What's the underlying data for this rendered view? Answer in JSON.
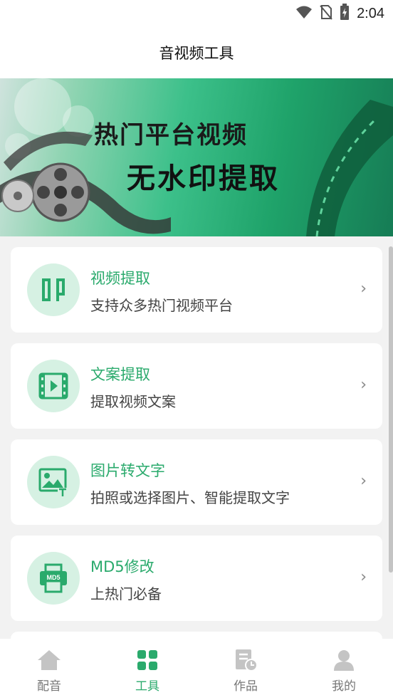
{
  "status_bar": {
    "time": "2:04",
    "icons": [
      "wifi-icon",
      "no-sim-icon",
      "battery-charging-icon"
    ]
  },
  "header": {
    "title": "音视频工具"
  },
  "banner": {
    "line1": "热门平台视频",
    "line2": "无水印提取",
    "decoration": "film-reel-icon"
  },
  "tools": [
    {
      "title": "视频提取",
      "subtitle": "支持众多热门视频平台",
      "icon": "video-extract-icon"
    },
    {
      "title": "文案提取",
      "subtitle": "提取视频文案",
      "icon": "film-play-icon"
    },
    {
      "title": "图片转文字",
      "subtitle": "拍照或选择图片、智能提取文字",
      "icon": "image-text-icon"
    },
    {
      "title": "MD5修改",
      "subtitle": "上热门必备",
      "icon": "printer-md5-icon",
      "icon_text": "MD5"
    }
  ],
  "chevron": "›",
  "tabs": [
    {
      "label": "配音",
      "icon": "home-icon",
      "active": false
    },
    {
      "label": "工具",
      "icon": "grid-icon",
      "active": true
    },
    {
      "label": "作品",
      "icon": "document-clock-icon",
      "active": false
    },
    {
      "label": "我的",
      "icon": "person-icon",
      "active": false
    }
  ],
  "colors": {
    "accent": "#2aaa6c",
    "icon_bg": "#d6f1e3",
    "inactive_icon": "#c4c4c4"
  }
}
